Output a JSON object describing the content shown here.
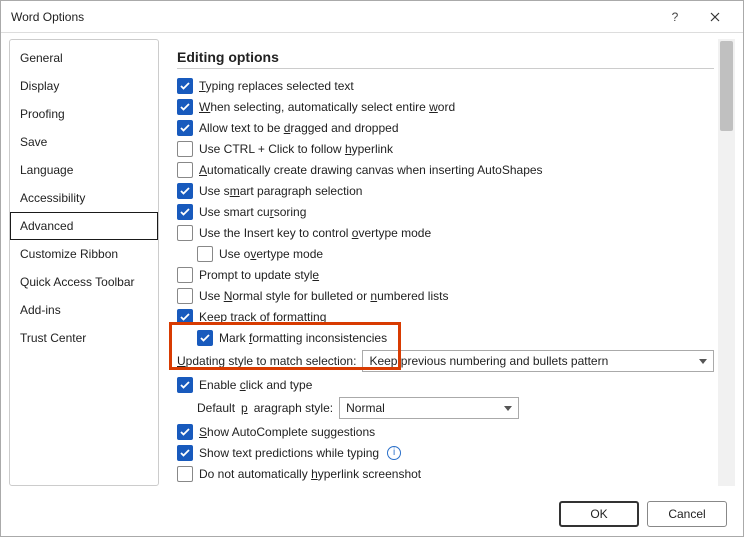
{
  "window": {
    "title": "Word Options"
  },
  "sidebar": {
    "items": [
      {
        "label": "General"
      },
      {
        "label": "Display"
      },
      {
        "label": "Proofing"
      },
      {
        "label": "Save"
      },
      {
        "label": "Language"
      },
      {
        "label": "Accessibility"
      },
      {
        "label": "Advanced",
        "selected": true
      },
      {
        "label": "Customize Ribbon"
      },
      {
        "label": "Quick Access Toolbar"
      },
      {
        "label": "Add-ins"
      },
      {
        "label": "Trust Center"
      }
    ]
  },
  "section_title": "Editing options",
  "options": {
    "typing_replaces": {
      "checked": true,
      "label": "Typing replaces selected text"
    },
    "select_word": {
      "checked": true,
      "label": "When selecting, automatically select entire word"
    },
    "drag_drop": {
      "checked": true,
      "label": "Allow text to be dragged and dropped"
    },
    "ctrl_click": {
      "checked": false,
      "label": "Use CTRL + Click to follow hyperlink"
    },
    "auto_canvas": {
      "checked": false,
      "label": "Automatically create drawing canvas when inserting AutoShapes"
    },
    "smart_para": {
      "checked": true,
      "label": "Use smart paragraph selection"
    },
    "smart_cursor": {
      "checked": true,
      "label": "Use smart cursoring"
    },
    "insert_key": {
      "checked": false,
      "label": "Use the Insert key to control overtype mode"
    },
    "overtype": {
      "checked": false,
      "label": "Use overtype mode"
    },
    "prompt_style": {
      "checked": false,
      "label": "Prompt to update style"
    },
    "normal_bullets": {
      "checked": false,
      "label": "Use Normal style for bulleted or numbered lists"
    },
    "track_format": {
      "checked": true,
      "label": "Keep track of formatting"
    },
    "mark_inconsist": {
      "checked": true,
      "label": "Mark formatting inconsistencies"
    },
    "update_style_label": "Updating style to match selection:",
    "update_style_value": "Keep previous numbering and bullets pattern",
    "click_type": {
      "checked": true,
      "label": "Enable click and type"
    },
    "default_para_label": "Default paragraph style:",
    "default_para_value": "Normal",
    "autocomplete": {
      "checked": true,
      "label": "Show AutoComplete suggestions"
    },
    "text_predictions": {
      "checked": true,
      "label": "Show text predictions while typing"
    },
    "no_hyperlink_screenshot": {
      "checked": false,
      "label": "Do not automatically hyperlink screenshot"
    }
  },
  "footer": {
    "ok": "OK",
    "cancel": "Cancel"
  }
}
